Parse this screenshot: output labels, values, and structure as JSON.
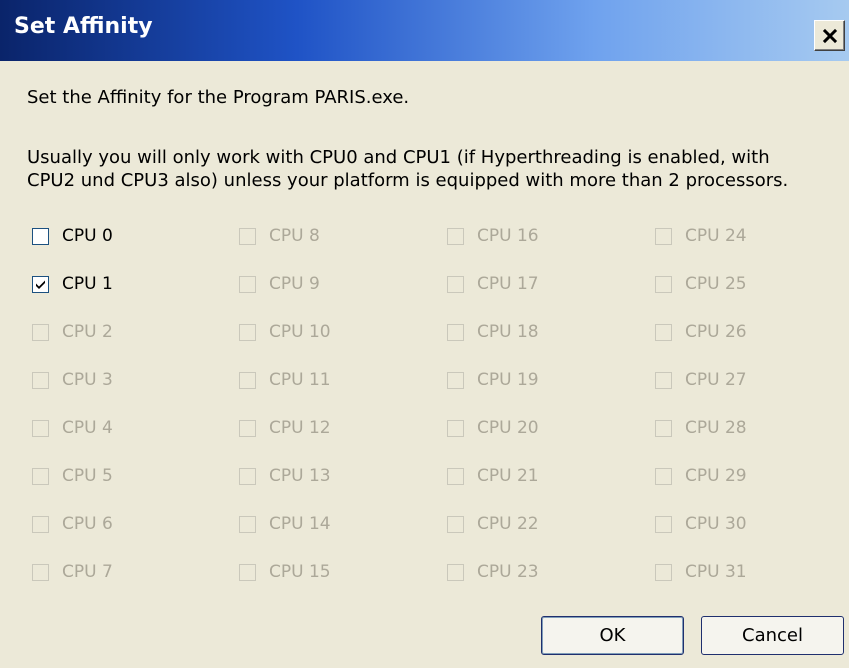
{
  "window": {
    "title": "Set Affinity",
    "close_label": "×"
  },
  "intro": "Set the Affinity for the Program PARIS.exe.",
  "note_line1": "Usually you will only work with CPU0 and CPU1 (if Hyperthreading is enabled, with",
  "note_line2": "CPU2 und CPU3 also) unless your platform is equipped with more than 2 processors.",
  "cpus": [
    {
      "label": "CPU 0",
      "checked": false,
      "enabled": true
    },
    {
      "label": "CPU 1",
      "checked": true,
      "enabled": true
    },
    {
      "label": "CPU 2",
      "checked": false,
      "enabled": false
    },
    {
      "label": "CPU 3",
      "checked": false,
      "enabled": false
    },
    {
      "label": "CPU 4",
      "checked": false,
      "enabled": false
    },
    {
      "label": "CPU 5",
      "checked": false,
      "enabled": false
    },
    {
      "label": "CPU 6",
      "checked": false,
      "enabled": false
    },
    {
      "label": "CPU 7",
      "checked": false,
      "enabled": false
    },
    {
      "label": "CPU 8",
      "checked": false,
      "enabled": false
    },
    {
      "label": "CPU 9",
      "checked": false,
      "enabled": false
    },
    {
      "label": "CPU 10",
      "checked": false,
      "enabled": false
    },
    {
      "label": "CPU 11",
      "checked": false,
      "enabled": false
    },
    {
      "label": "CPU 12",
      "checked": false,
      "enabled": false
    },
    {
      "label": "CPU 13",
      "checked": false,
      "enabled": false
    },
    {
      "label": "CPU 14",
      "checked": false,
      "enabled": false
    },
    {
      "label": "CPU 15",
      "checked": false,
      "enabled": false
    },
    {
      "label": "CPU 16",
      "checked": false,
      "enabled": false
    },
    {
      "label": "CPU 17",
      "checked": false,
      "enabled": false
    },
    {
      "label": "CPU 18",
      "checked": false,
      "enabled": false
    },
    {
      "label": "CPU 19",
      "checked": false,
      "enabled": false
    },
    {
      "label": "CPU 20",
      "checked": false,
      "enabled": false
    },
    {
      "label": "CPU 21",
      "checked": false,
      "enabled": false
    },
    {
      "label": "CPU 22",
      "checked": false,
      "enabled": false
    },
    {
      "label": "CPU 23",
      "checked": false,
      "enabled": false
    },
    {
      "label": "CPU 24",
      "checked": false,
      "enabled": false
    },
    {
      "label": "CPU 25",
      "checked": false,
      "enabled": false
    },
    {
      "label": "CPU 26",
      "checked": false,
      "enabled": false
    },
    {
      "label": "CPU 27",
      "checked": false,
      "enabled": false
    },
    {
      "label": "CPU 28",
      "checked": false,
      "enabled": false
    },
    {
      "label": "CPU 29",
      "checked": false,
      "enabled": false
    },
    {
      "label": "CPU 30",
      "checked": false,
      "enabled": false
    },
    {
      "label": "CPU 31",
      "checked": false,
      "enabled": false
    }
  ],
  "buttons": {
    "ok": "OK",
    "cancel": "Cancel"
  },
  "colors": {
    "titlebar_start": "#0A246A",
    "titlebar_end": "#A6CAF0",
    "dialog_bg": "#ECE9D8",
    "disabled_text": "#ACA899"
  },
  "icons": {
    "close": "close-icon",
    "check": "checkmark-icon"
  }
}
